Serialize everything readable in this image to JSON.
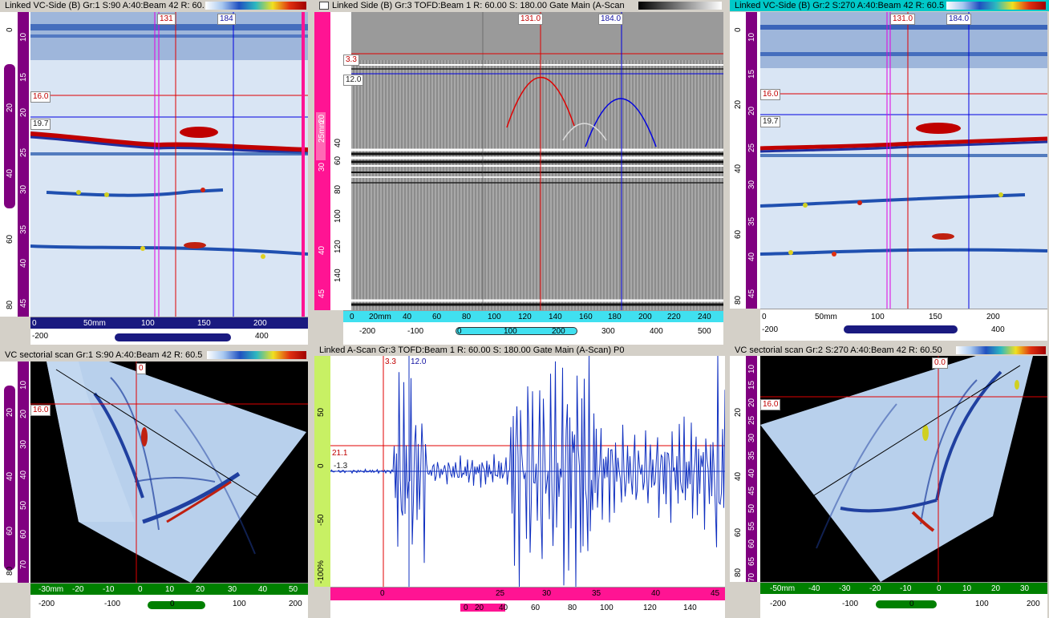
{
  "palette_colors": [
    "#ffffff",
    "#a8c8f0",
    "#2050c0",
    "#2db8c0",
    "#f0e020",
    "#e03010",
    "#a00000"
  ],
  "colors": {
    "active_title": "#00c8c8",
    "magenta_ruler": "#ff1493",
    "purple_bar": "#800080",
    "cyan_ruler": "#40e0f0",
    "green_ruler": "#008000",
    "lime_bar": "#c8f064",
    "cursor_red": "#e00000",
    "cursor_blue": "#0000e0",
    "cursor_magenta": "#e000e0",
    "ascan_line": "#1030c0"
  },
  "panes": {
    "tl": {
      "title": "Linked VC-Side (B) Gr:1 S:90 A:40:Beam 42   R: 60.",
      "top_tags": [
        "131",
        "184"
      ],
      "left_tags": [
        "16.0",
        "19.7"
      ],
      "vticks": [
        "10",
        "15",
        "20",
        "25",
        "30",
        "35",
        "40",
        "45"
      ],
      "vticks_outer": [
        "0",
        "20",
        "40",
        "60",
        "80"
      ],
      "hticks": [
        "0",
        "50mm",
        "100",
        "150",
        "200"
      ],
      "hticks2": [
        "-200",
        "400"
      ]
    },
    "tm": {
      "title": "Linked Side (B) Gr:3 TOFD:Beam 1   R: 60.00 S: 180.00 Gate Main (A-Scan",
      "top_tags": [
        "131.0",
        "184.0"
      ],
      "left_tags": [
        "3.3",
        "12.0"
      ],
      "vticks": [
        "40",
        "60",
        "80",
        "100",
        "120",
        "140"
      ],
      "vticks_inner": [
        "20",
        "25mm",
        "30",
        "40",
        "45"
      ],
      "hticks": [
        "0",
        "20mm",
        "40",
        "60",
        "80",
        "100",
        "120",
        "140",
        "160",
        "180",
        "200",
        "220",
        "240"
      ],
      "hticks2": [
        "-200",
        "-100",
        "0",
        "100",
        "200",
        "300",
        "400",
        "500"
      ]
    },
    "tr": {
      "title": "Linked VC-Side (B) Gr:2 S:270 A:40:Beam 42   R: 60.5",
      "top_tags": [
        "131.0",
        "184.0"
      ],
      "left_tags": [
        "16.0",
        "19.7"
      ],
      "vticks": [
        "10",
        "15",
        "20",
        "25",
        "30",
        "35",
        "40",
        "45"
      ],
      "vticks_outer": [
        "0",
        "20",
        "40",
        "60",
        "80"
      ],
      "hticks": [
        "0",
        "50mm",
        "100",
        "150",
        "200"
      ],
      "hticks2": [
        "-200",
        "400"
      ]
    },
    "bl": {
      "title": "VC sectorial scan Gr:1 S:90 A:40:Beam 42   R: 60.5",
      "top_tags": [
        "0"
      ],
      "left_tags": [
        "16.0"
      ],
      "vticks": [
        "10",
        "20",
        "30",
        "40",
        "50",
        "60",
        "70"
      ],
      "vticks_outer": [
        "20",
        "40",
        "60",
        "80"
      ],
      "hticks": [
        "-30mm",
        "-20",
        "-10",
        "0",
        "10",
        "20",
        "30",
        "40",
        "50"
      ],
      "hticks2": [
        "-200",
        "-100",
        "0",
        "100",
        "200"
      ]
    },
    "bm": {
      "title": "Linked A-Scan Gr:3 TOFD:Beam 1   R: 60.00 S: 180.00 Gate Main (A-Scan) P0",
      "top_tags": [
        "3.3",
        "12.0"
      ],
      "left_tags": [
        "21.1",
        "-1.3"
      ],
      "vticks": [
        "50",
        "0",
        "-50",
        "-100%"
      ],
      "hticks": [
        "0",
        "25",
        "30",
        "35",
        "40",
        "45"
      ],
      "hticks2": [
        "0",
        "20",
        "40",
        "60",
        "80",
        "100",
        "120",
        "140"
      ]
    },
    "br": {
      "title": "VC sectorial scan Gr:2 S:270 A:40:Beam 42   R: 60.50",
      "top_tags": [
        "0.0"
      ],
      "left_tags": [
        "16.0"
      ],
      "vticks": [
        "10",
        "15",
        "20",
        "25",
        "30",
        "35",
        "40",
        "45",
        "50",
        "55",
        "60",
        "65",
        "70"
      ],
      "vticks_outer": [
        "20",
        "40",
        "60",
        "80"
      ],
      "hticks": [
        "-50mm",
        "-40",
        "-30",
        "-20",
        "-10",
        "0",
        "10",
        "20",
        "30"
      ],
      "hticks2": [
        "-200",
        "-100",
        "0",
        "100",
        "200"
      ]
    }
  }
}
